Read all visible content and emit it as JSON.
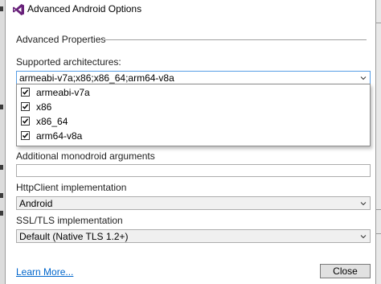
{
  "window": {
    "title": "Advanced Android Options",
    "icon": "visual-studio-icon",
    "accent": "#68217a"
  },
  "section": {
    "title": "Advanced Properties"
  },
  "architectures": {
    "label": "Supported architectures:",
    "value": "armeabi-v7a;x86;x86_64;arm64-v8a",
    "options": [
      {
        "label": "armeabi-v7a",
        "checked": true
      },
      {
        "label": "x86",
        "checked": true
      },
      {
        "label": "x86_64",
        "checked": true
      },
      {
        "label": "arm64-v8a",
        "checked": true
      }
    ]
  },
  "monodroid": {
    "label": "Additional monodroid arguments",
    "value": ""
  },
  "httpclient": {
    "label": "HttpClient implementation",
    "value": "Android"
  },
  "ssl": {
    "label": "SSL/TLS implementation",
    "value": "Default (Native TLS 1.2+)"
  },
  "footer": {
    "learn_more": "Learn More...",
    "close": "Close"
  }
}
